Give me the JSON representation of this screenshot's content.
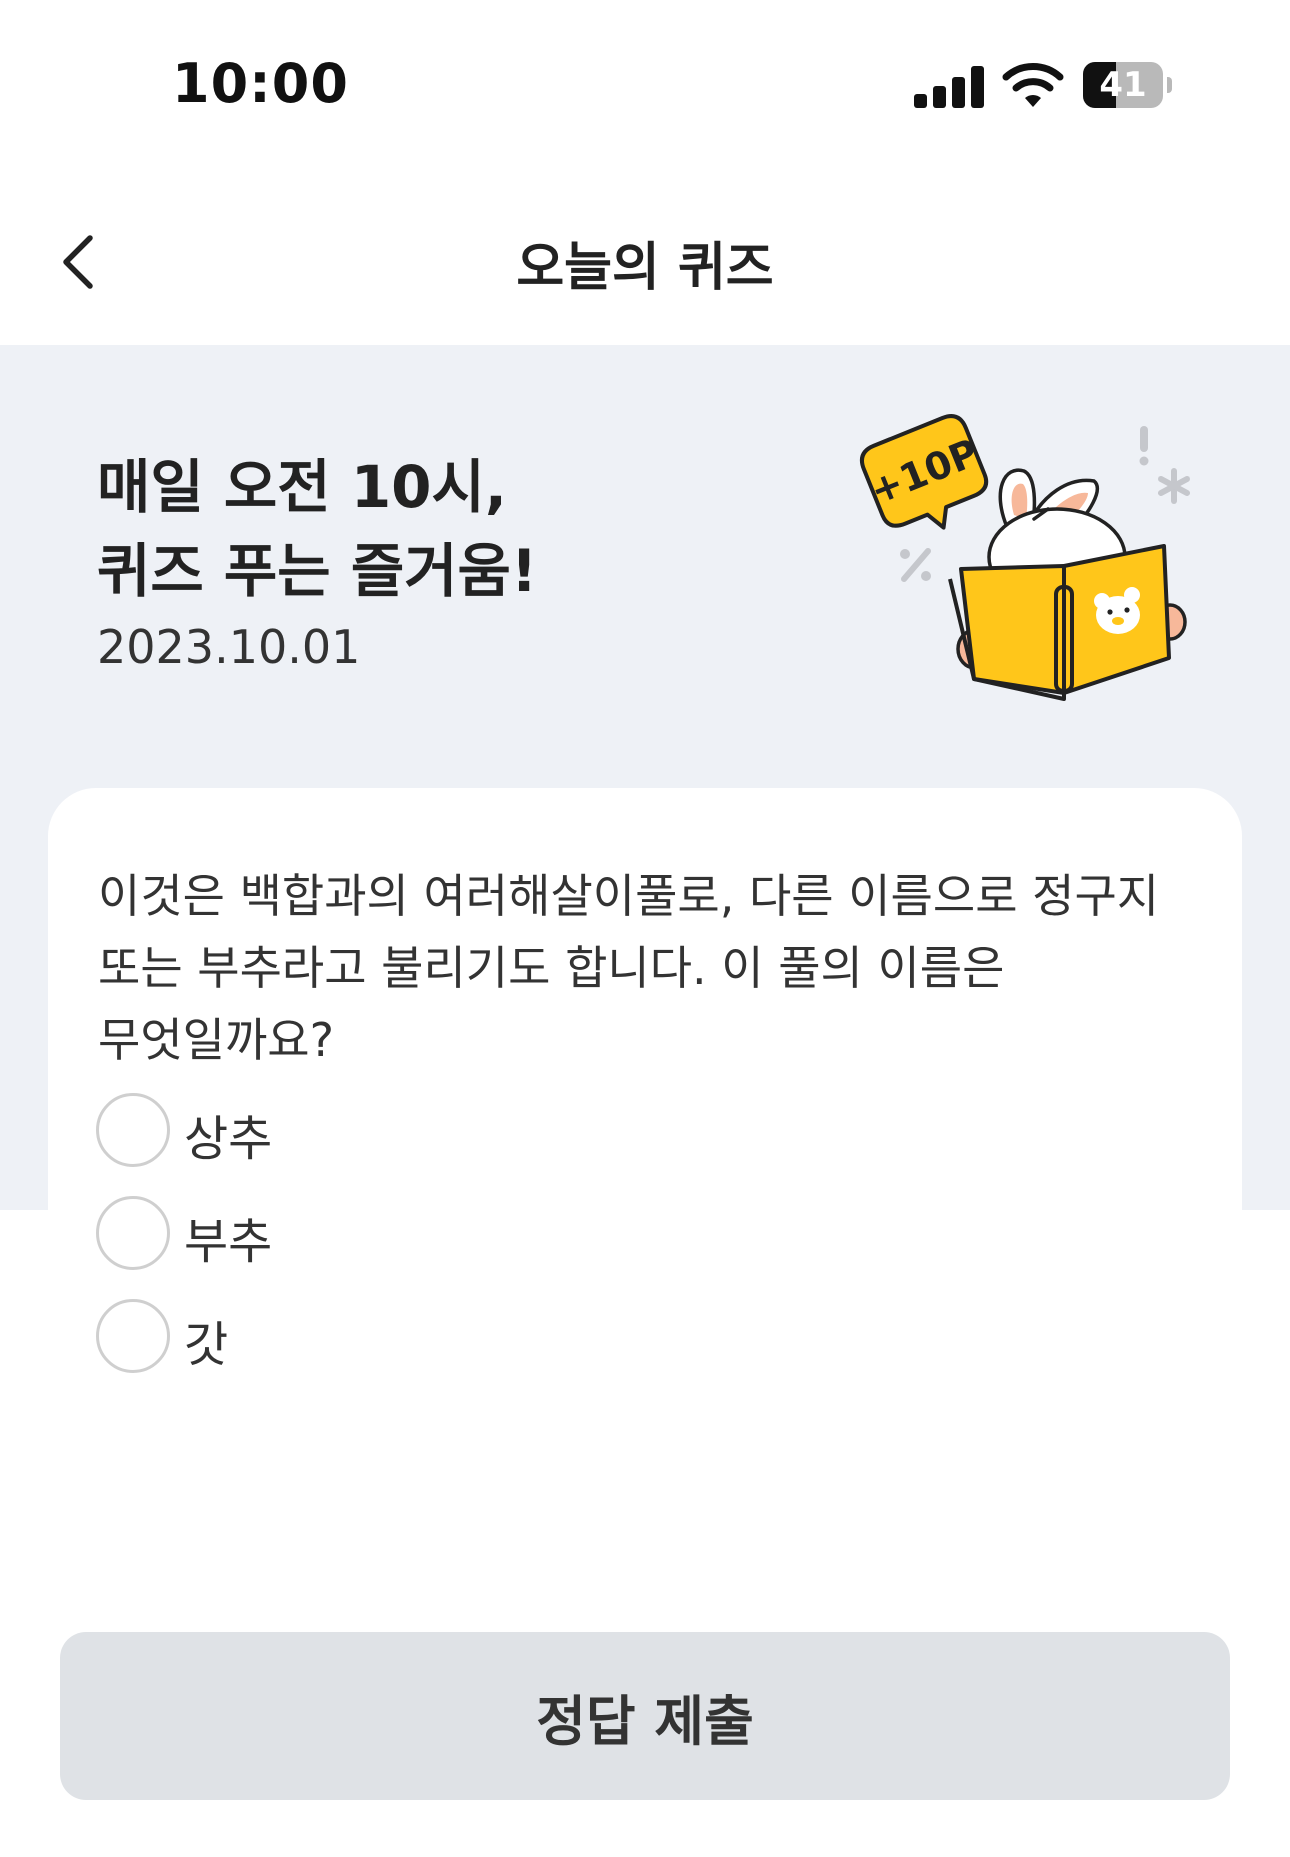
{
  "status_bar": {
    "time": "10:00",
    "battery_level": "41",
    "battery_fraction": 0.41
  },
  "header": {
    "title": "오늘의 퀴즈"
  },
  "hero": {
    "title_line1": "매일 오전 10시,",
    "title_line2": "퀴즈 푸는 즐거움!",
    "date": "2023.10.01",
    "badge_text": "+10P"
  },
  "quiz": {
    "question": "이것은 백합과의 여러해살이풀로, 다른 이름으로 정구지 또는 부추라고 불리기도 합니다. 이 풀의 이름은 무엇일까요?",
    "options": [
      {
        "label": "상추"
      },
      {
        "label": "부추"
      },
      {
        "label": "갓"
      }
    ]
  },
  "actions": {
    "submit_label": "정답 제출"
  },
  "colors": {
    "hero_background": "#eef1f6",
    "book_yellow": "#ffc61a",
    "button_disabled": "#dfe2e6"
  }
}
